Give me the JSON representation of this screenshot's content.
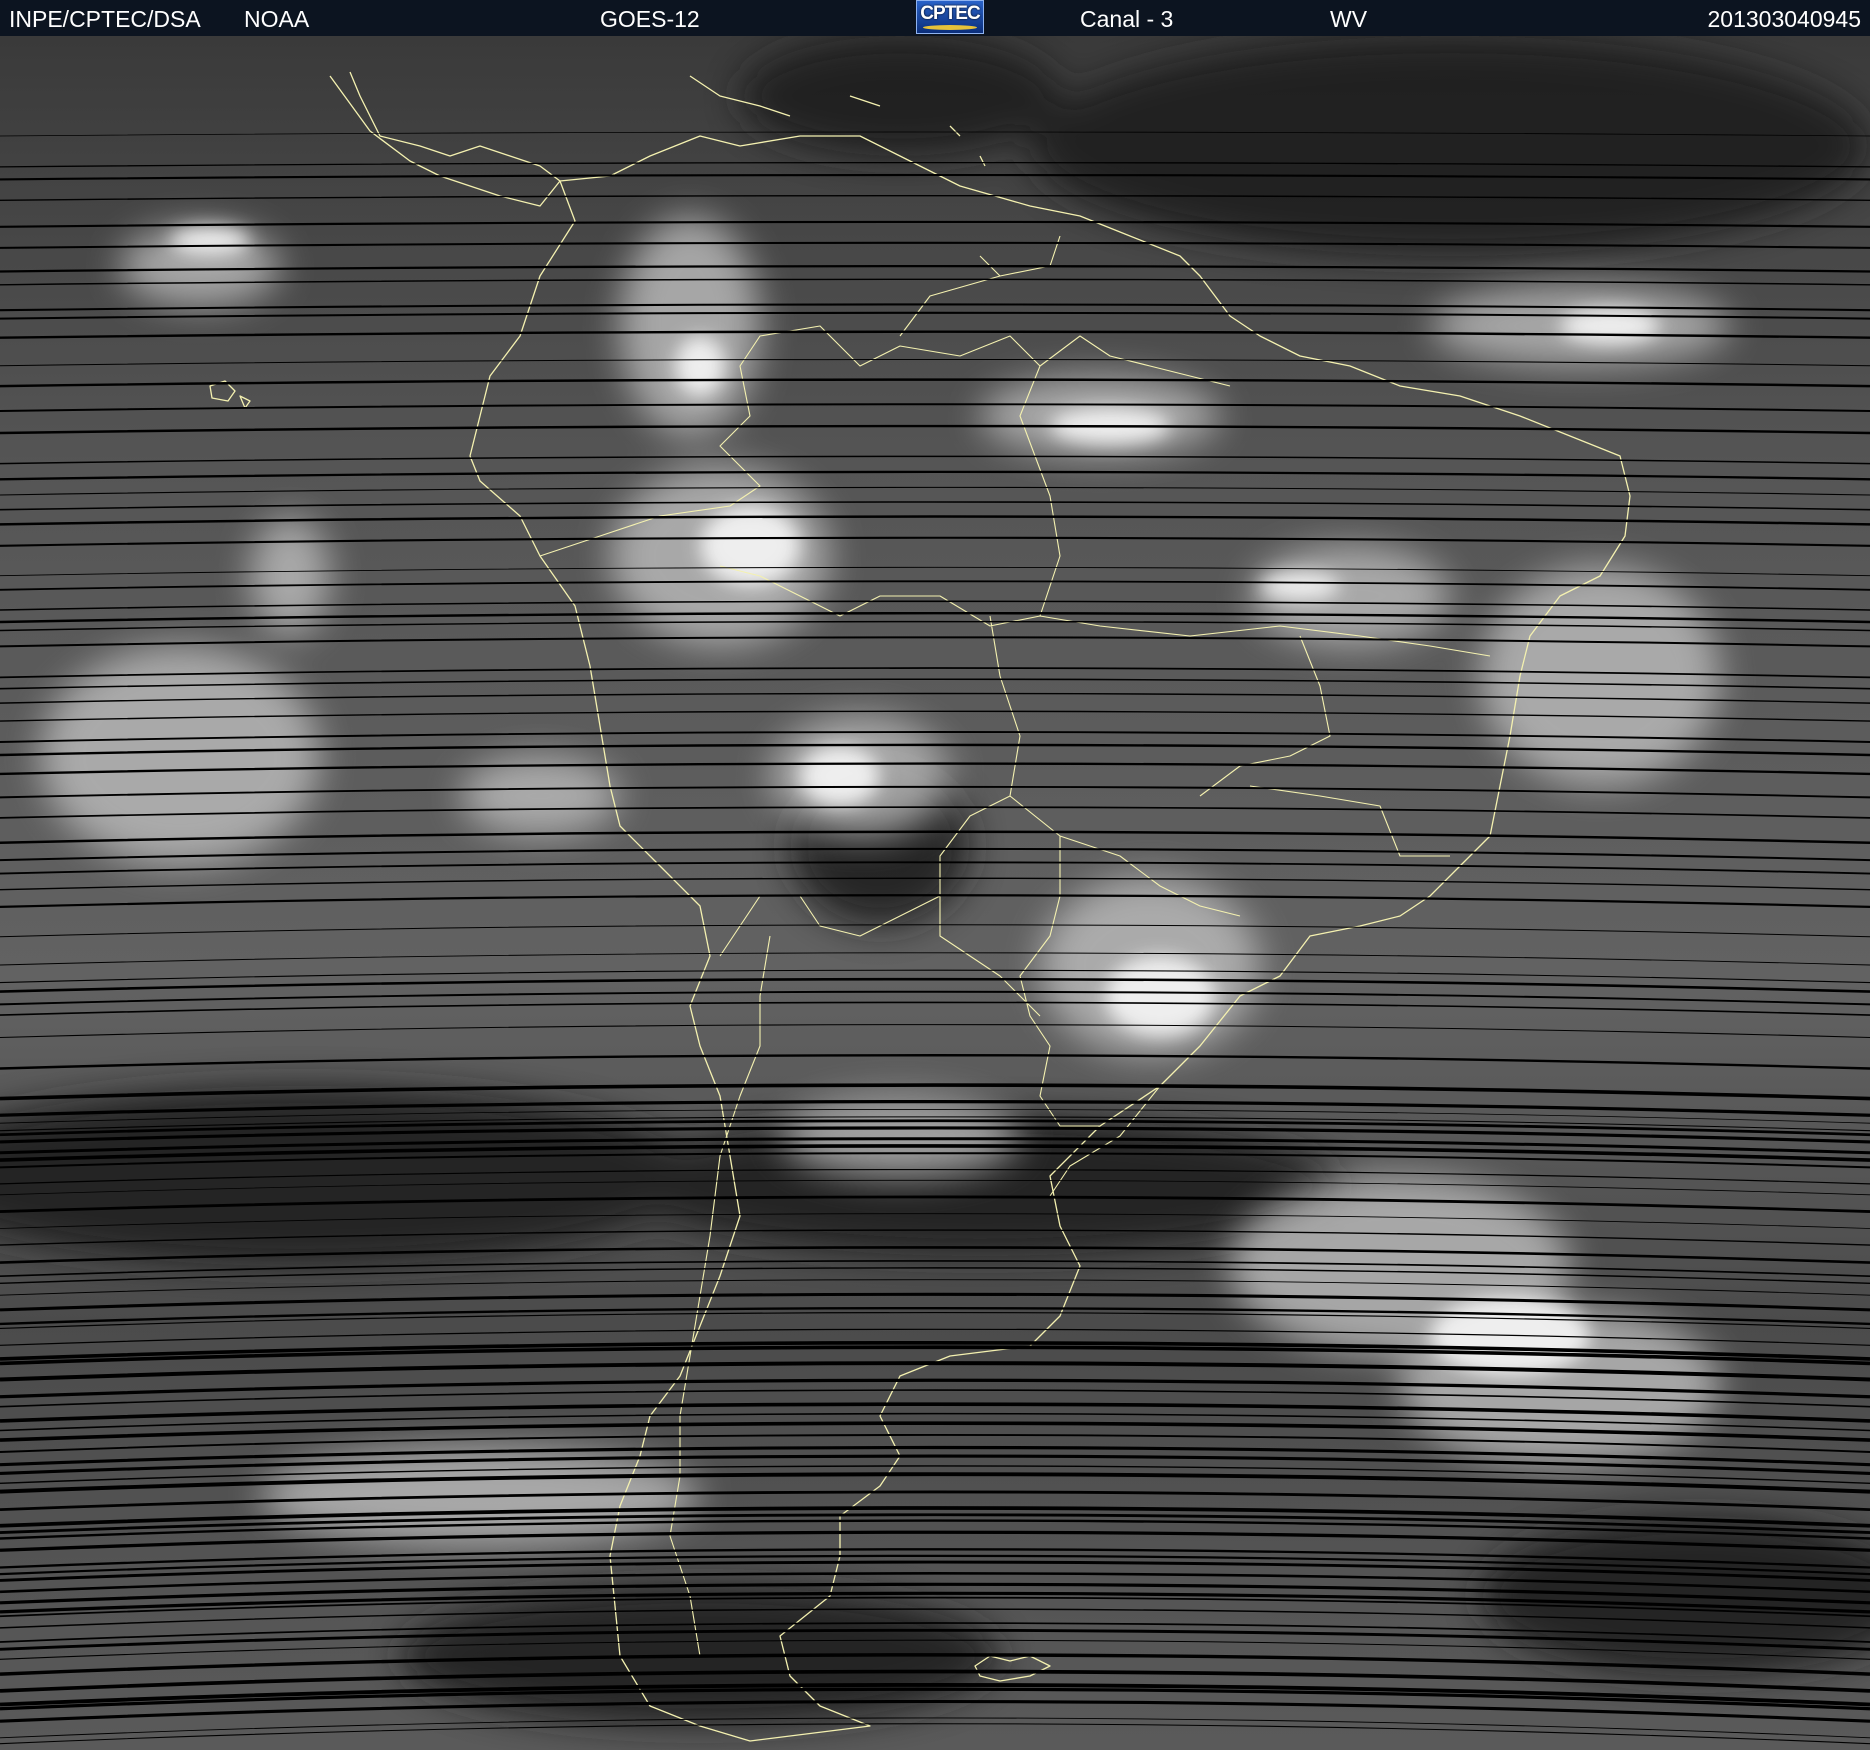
{
  "header": {
    "organization": "INPE/CPTEC/DSA",
    "agency": "NOAA",
    "satellite": "GOES-12",
    "logo_text": "CPTEC",
    "channel": "Canal - 3",
    "band": "WV",
    "timestamp": "201303040945"
  },
  "colors": {
    "header_bg": "#0c1420",
    "header_text": "#ffffff",
    "coastline": "#f4f1b0",
    "scan_line": "#000000",
    "logo_blue": "#1f4fb0"
  },
  "map": {
    "region": "South America",
    "image_type": "water vapor satellite imagery, grayscale",
    "overlay": "coastlines and political borders",
    "artifacts": "horizontal black scan-line dropouts"
  }
}
